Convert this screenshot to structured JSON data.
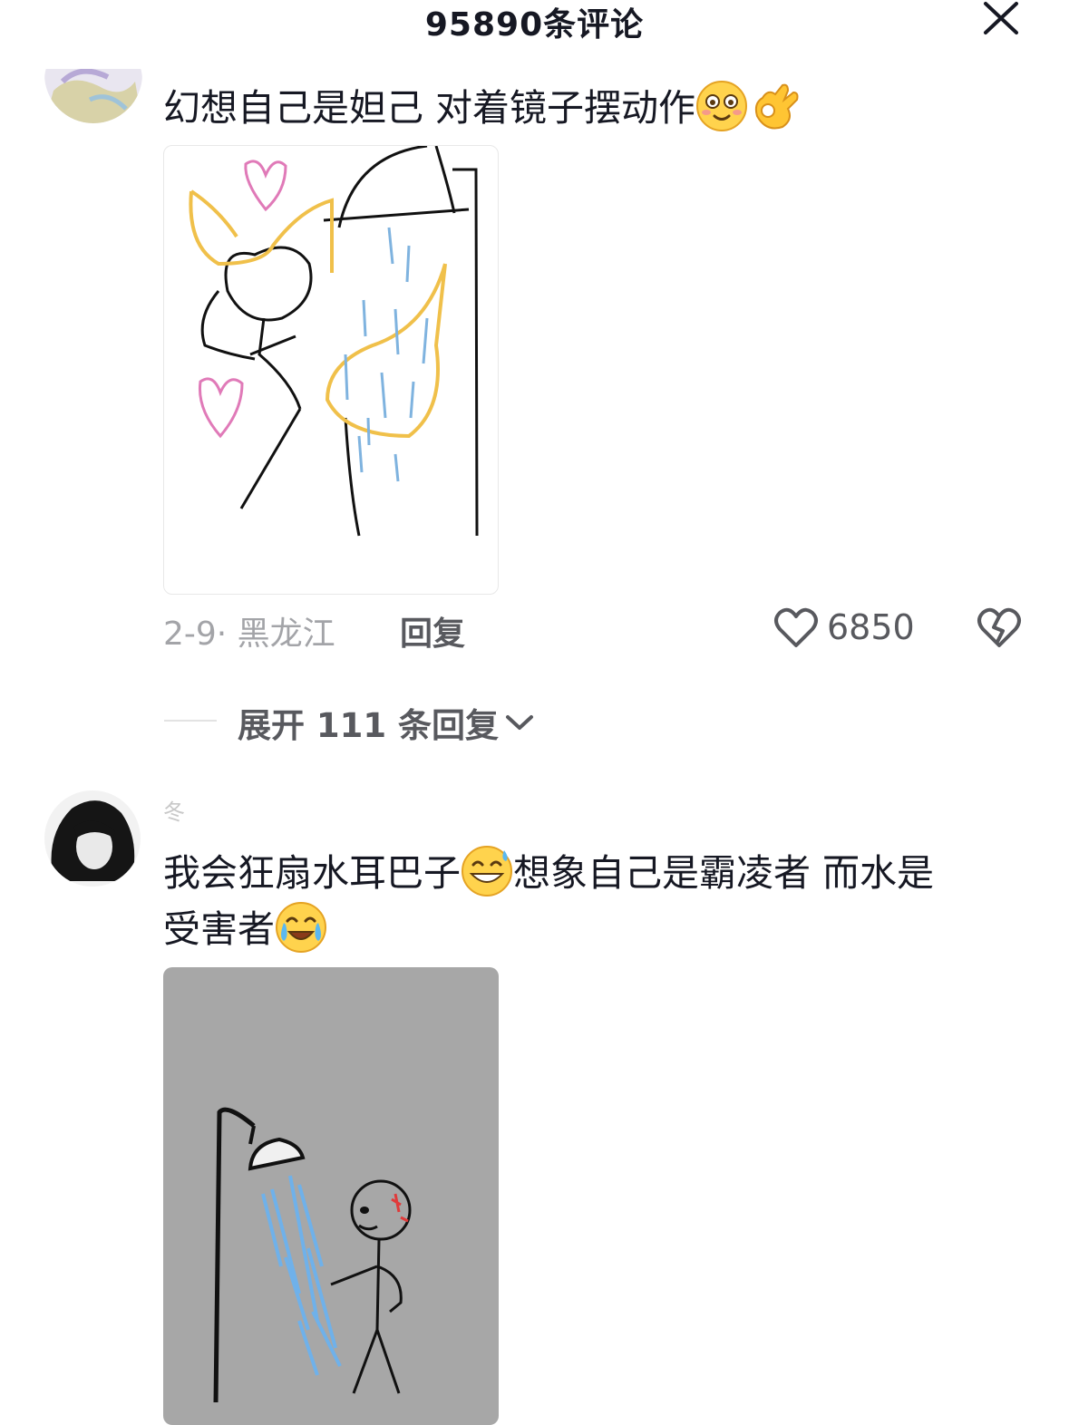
{
  "header": {
    "title": "95890条评论",
    "close_icon": "close-icon"
  },
  "comments": [
    {
      "avatar_icon": "avatar-anime",
      "text": "幻想自己是妲己 对着镜子摆动作",
      "emojis": [
        "blush-smile-emoji",
        "ok-hand-emoji"
      ],
      "image": "drawing-mirror-dance",
      "meta": "2-9· 黑龙江",
      "reply_label": "回复",
      "likes": "6850",
      "expand_label": "展开 111 条回复"
    },
    {
      "avatar_icon": "avatar-dark-hair",
      "username": "冬",
      "text_line1": "我会狂扇水耳巴子",
      "text_line1b": "想象自己是霸凌者 而水是",
      "text_line2": "受害者",
      "emojis": [
        "grin-sweat-emoji",
        "tears-joy-emoji"
      ],
      "image": "drawing-shower-slap"
    }
  ]
}
